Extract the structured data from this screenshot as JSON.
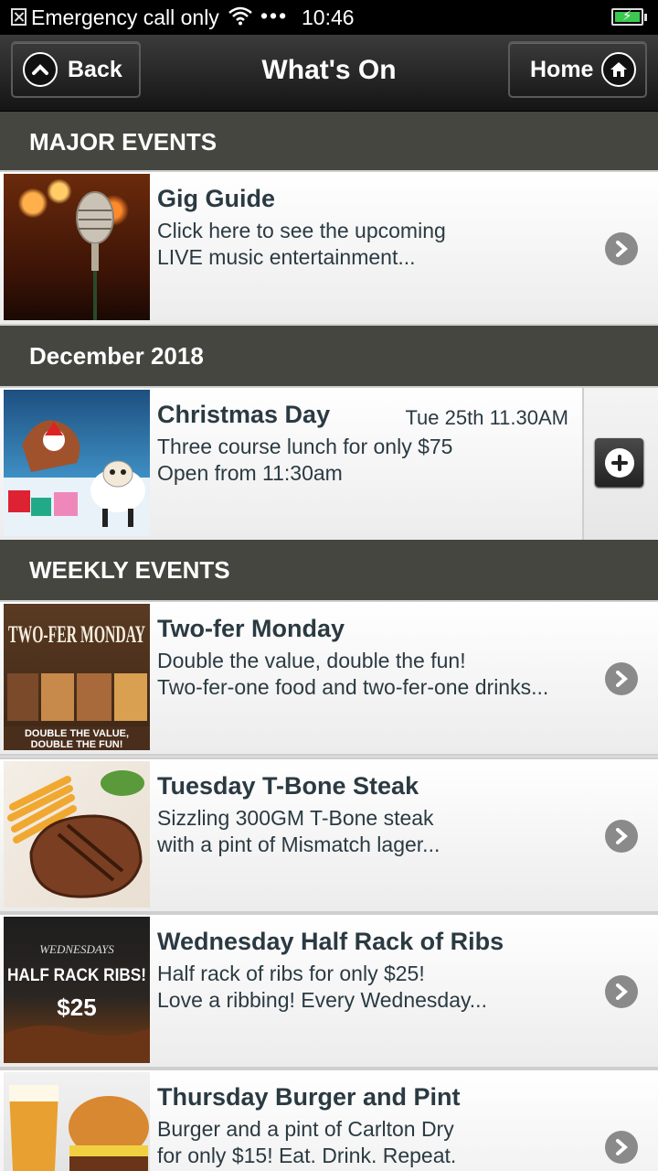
{
  "status_bar": {
    "carrier": "Emergency call only",
    "time": "10:46",
    "dots": "•••"
  },
  "header": {
    "back_label": "Back",
    "title": "What's On",
    "home_label": "Home"
  },
  "sections": {
    "major": "MAJOR EVENTS",
    "december": "December 2018",
    "weekly": "WEEKLY EVENTS"
  },
  "events": {
    "gig": {
      "title": "Gig Guide",
      "line1": "Click here to see the upcoming",
      "line2": "LIVE music entertainment..."
    },
    "christmas": {
      "title": "Christmas Day",
      "date": "Tue 25th 11.30AM",
      "line1": "Three course lunch for only $75",
      "line2": "Open from 11:30am"
    },
    "monday": {
      "title": "Two-fer Monday",
      "line1": "Double the value, double the fun!",
      "line2": "Two-fer-one food and two-fer-one drinks...",
      "img_heading": "TWO-FER MONDAY",
      "img_caption1": "DOUBLE THE VALUE,",
      "img_caption2": "DOUBLE THE FUN!"
    },
    "tuesday": {
      "title": "Tuesday T-Bone Steak",
      "line1": "Sizzling 300GM T-Bone steak",
      "line2": "with a pint of Mismatch lager..."
    },
    "wednesday": {
      "title": "Wednesday Half Rack of Ribs",
      "line1": "Half rack of ribs for only $25!",
      "line2": "Love a ribbing! Every Wednesday...",
      "img_small": "WEDNESDAYS",
      "img_heading": "HALF RACK RIBS!",
      "img_price": "$25"
    },
    "thursday": {
      "title": "Thursday Burger and Pint",
      "line1": "Burger and a pint of Carlton Dry",
      "line2": "for only $15! Eat. Drink. Repeat."
    }
  }
}
